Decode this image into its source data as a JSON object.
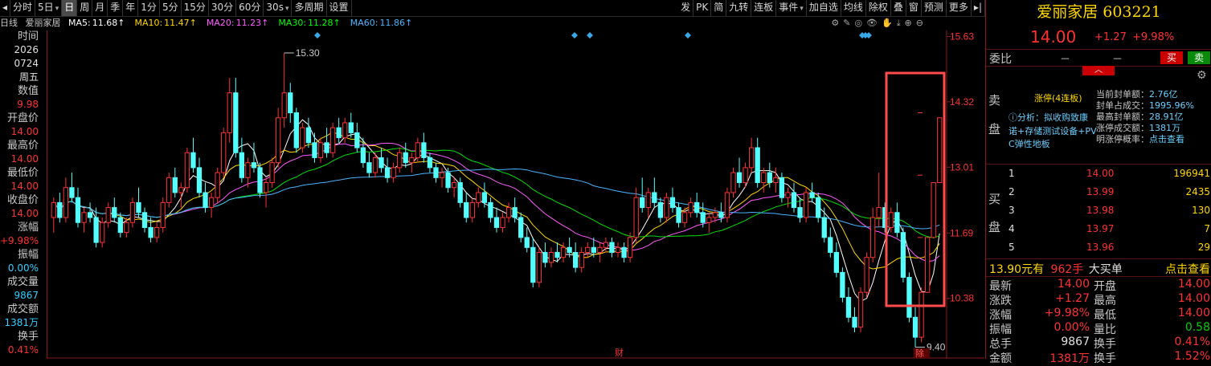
{
  "toolbar": {
    "left_items": [
      "分时",
      "5日",
      "日",
      "周",
      "月",
      "季",
      "年",
      "1分",
      "5分",
      "15分",
      "30分",
      "60分",
      "30s",
      "多周期",
      "设置"
    ],
    "active_item": "日",
    "right_items": [
      "发",
      "PK",
      "简",
      "九转",
      "连板",
      "事件",
      "加自选",
      "均线",
      "除权",
      "叠",
      "窗",
      "预测",
      "更多"
    ]
  },
  "infobar": {
    "period": "日线",
    "name": "爱丽家居",
    "ma": [
      {
        "label": "MA5:",
        "value": "11.68",
        "color": "#ffffff"
      },
      {
        "label": "MA10:",
        "value": "11.47",
        "color": "#ffd700"
      },
      {
        "label": "MA20:",
        "value": "11.23",
        "color": "#ff5aff"
      },
      {
        "label": "MA30:",
        "value": "11.28",
        "color": "#00ff00"
      },
      {
        "label": "MA60:",
        "value": "11.86",
        "color": "#4ab4ff"
      }
    ],
    "arrow": "↑"
  },
  "left_panel": [
    {
      "text": "时间",
      "kind": "lbl"
    },
    {
      "text": "2026",
      "kind": "val-white"
    },
    {
      "text": "0724",
      "kind": "val-white"
    },
    {
      "text": "周五",
      "kind": "val-white"
    },
    {
      "text": "数值",
      "kind": "lbl"
    },
    {
      "text": "9.98",
      "kind": "val-red"
    },
    {
      "text": "开盘价",
      "kind": "lbl"
    },
    {
      "text": "14.00",
      "kind": "val-red"
    },
    {
      "text": "最高价",
      "kind": "lbl"
    },
    {
      "text": "14.00",
      "kind": "val-red"
    },
    {
      "text": "最低价",
      "kind": "lbl"
    },
    {
      "text": "14.00",
      "kind": "val-red"
    },
    {
      "text": "收盘价",
      "kind": "lbl"
    },
    {
      "text": "14.00",
      "kind": "val-red"
    },
    {
      "text": "涨幅",
      "kind": "lbl"
    },
    {
      "text": "+9.98%",
      "kind": "val-red"
    },
    {
      "text": "振幅",
      "kind": "lbl"
    },
    {
      "text": "0.00%",
      "kind": "val-cyan"
    },
    {
      "text": "成交量",
      "kind": "lbl"
    },
    {
      "text": "9867",
      "kind": "val-cyan"
    },
    {
      "text": "成交额",
      "kind": "lbl"
    },
    {
      "text": "1381万",
      "kind": "val-cyan"
    },
    {
      "text": "换手",
      "kind": "lbl"
    },
    {
      "text": "0.41%",
      "kind": "val-red"
    }
  ],
  "chart_data": {
    "type": "candlestick",
    "y_ticks": [
      "15.63",
      "14.32",
      "13.01",
      "11.69",
      "10.38"
    ],
    "y_tick_values": [
      15.63,
      14.32,
      13.01,
      11.69,
      10.38
    ],
    "ylim": [
      9.2,
      15.75
    ],
    "high_label": "15.30",
    "low_label": "9.40",
    "markers": [
      "财",
      "除"
    ],
    "candles": [
      [
        12.0,
        12.4,
        11.7,
        12.3
      ],
      [
        12.3,
        12.5,
        11.9,
        12.0
      ],
      [
        12.0,
        12.8,
        11.9,
        12.6
      ],
      [
        12.6,
        12.9,
        12.3,
        12.4
      ],
      [
        12.4,
        12.6,
        11.8,
        11.9
      ],
      [
        11.9,
        12.2,
        11.7,
        12.1
      ],
      [
        12.1,
        12.3,
        11.9,
        12.0
      ],
      [
        12.0,
        12.2,
        11.4,
        11.5
      ],
      [
        11.5,
        12.0,
        11.4,
        11.9
      ],
      [
        11.9,
        12.3,
        11.8,
        12.2
      ],
      [
        12.2,
        12.4,
        11.9,
        12.0
      ],
      [
        12.0,
        12.1,
        11.6,
        11.7
      ],
      [
        11.7,
        12.0,
        11.6,
        11.9
      ],
      [
        11.9,
        12.4,
        11.8,
        12.3
      ],
      [
        12.3,
        12.6,
        12.0,
        12.1
      ],
      [
        12.1,
        12.2,
        11.7,
        11.8
      ],
      [
        11.8,
        12.0,
        11.5,
        11.6
      ],
      [
        11.6,
        11.9,
        11.5,
        11.8
      ],
      [
        11.8,
        12.4,
        11.7,
        12.3
      ],
      [
        12.3,
        12.9,
        12.2,
        12.8
      ],
      [
        12.8,
        13.0,
        12.4,
        12.5
      ],
      [
        12.5,
        12.7,
        12.2,
        12.6
      ],
      [
        12.6,
        13.4,
        12.5,
        13.3
      ],
      [
        13.3,
        13.6,
        12.9,
        13.0
      ],
      [
        13.0,
        13.2,
        12.4,
        12.5
      ],
      [
        12.5,
        12.7,
        12.1,
        12.2
      ],
      [
        12.2,
        12.5,
        12.0,
        12.4
      ],
      [
        12.4,
        13.0,
        12.3,
        12.9
      ],
      [
        12.9,
        13.8,
        12.8,
        13.7
      ],
      [
        13.7,
        14.8,
        13.5,
        14.5
      ],
      [
        14.5,
        14.8,
        13.2,
        13.3
      ],
      [
        13.3,
        13.6,
        12.7,
        12.8
      ],
      [
        12.8,
        13.2,
        12.6,
        13.1
      ],
      [
        13.1,
        13.5,
        12.9,
        13.0
      ],
      [
        13.0,
        13.1,
        12.4,
        12.5
      ],
      [
        12.5,
        12.8,
        12.2,
        12.7
      ],
      [
        12.7,
        13.2,
        12.6,
        13.1
      ],
      [
        13.1,
        14.2,
        13.0,
        14.0
      ],
      [
        14.0,
        15.3,
        13.8,
        14.5
      ],
      [
        14.5,
        14.7,
        13.9,
        14.1
      ],
      [
        14.1,
        14.2,
        13.3,
        13.4
      ],
      [
        13.4,
        13.9,
        13.3,
        13.8
      ],
      [
        13.8,
        14.0,
        13.4,
        13.5
      ],
      [
        13.5,
        13.7,
        13.1,
        13.2
      ],
      [
        13.2,
        13.6,
        13.1,
        13.5
      ],
      [
        13.5,
        13.8,
        13.2,
        13.3
      ],
      [
        13.3,
        13.9,
        13.2,
        13.8
      ],
      [
        13.8,
        14.0,
        13.5,
        13.6
      ],
      [
        13.6,
        14.0,
        13.5,
        13.9
      ],
      [
        13.9,
        14.1,
        13.6,
        13.7
      ],
      [
        13.7,
        13.9,
        13.3,
        13.4
      ],
      [
        13.4,
        13.6,
        13.0,
        13.1
      ],
      [
        13.1,
        13.3,
        12.8,
        12.9
      ],
      [
        12.9,
        13.3,
        12.8,
        13.2
      ],
      [
        13.2,
        13.4,
        12.9,
        13.0
      ],
      [
        13.0,
        13.2,
        12.7,
        12.8
      ],
      [
        12.8,
        13.1,
        12.7,
        13.0
      ],
      [
        13.0,
        13.4,
        12.9,
        13.3
      ],
      [
        13.3,
        13.5,
        13.0,
        13.1
      ],
      [
        13.1,
        13.3,
        12.9,
        13.2
      ],
      [
        13.2,
        13.6,
        13.1,
        13.5
      ],
      [
        13.5,
        13.7,
        13.1,
        13.2
      ],
      [
        13.2,
        13.3,
        12.9,
        13.0
      ],
      [
        13.0,
        13.1,
        12.7,
        12.8
      ],
      [
        12.8,
        13.0,
        12.6,
        12.9
      ],
      [
        12.9,
        13.0,
        12.5,
        12.6
      ],
      [
        12.6,
        12.8,
        12.4,
        12.7
      ],
      [
        12.7,
        12.8,
        12.2,
        12.3
      ],
      [
        12.3,
        12.5,
        11.9,
        12.0
      ],
      [
        12.0,
        12.4,
        11.9,
        12.3
      ],
      [
        12.3,
        12.6,
        12.2,
        12.5
      ],
      [
        12.5,
        12.7,
        12.2,
        12.3
      ],
      [
        12.3,
        12.4,
        11.9,
        12.0
      ],
      [
        12.0,
        12.2,
        11.7,
        11.8
      ],
      [
        11.8,
        12.1,
        11.7,
        12.0
      ],
      [
        12.0,
        12.3,
        11.9,
        12.2
      ],
      [
        12.2,
        12.4,
        11.9,
        12.0
      ],
      [
        12.0,
        12.1,
        11.5,
        11.6
      ],
      [
        11.6,
        11.8,
        11.3,
        11.4
      ],
      [
        11.4,
        11.6,
        10.6,
        10.7
      ],
      [
        10.7,
        11.4,
        10.6,
        11.3
      ],
      [
        11.3,
        11.5,
        11.0,
        11.1
      ],
      [
        11.1,
        11.4,
        11.0,
        11.3
      ],
      [
        11.3,
        11.5,
        11.1,
        11.2
      ],
      [
        11.2,
        11.5,
        11.1,
        11.4
      ],
      [
        11.4,
        11.6,
        11.2,
        11.3
      ],
      [
        11.3,
        11.5,
        10.9,
        11.0
      ],
      [
        11.0,
        11.4,
        10.9,
        11.3
      ],
      [
        11.3,
        11.5,
        11.2,
        11.4
      ],
      [
        11.4,
        11.6,
        11.2,
        11.3
      ],
      [
        11.3,
        11.5,
        11.1,
        11.4
      ],
      [
        11.4,
        11.6,
        11.3,
        11.5
      ],
      [
        11.5,
        11.6,
        11.2,
        11.3
      ],
      [
        11.3,
        11.5,
        11.2,
        11.4
      ],
      [
        11.4,
        11.5,
        11.1,
        11.2
      ],
      [
        11.2,
        11.7,
        11.1,
        11.6
      ],
      [
        11.6,
        12.6,
        11.5,
        12.4
      ],
      [
        12.4,
        12.8,
        12.1,
        12.2
      ],
      [
        12.2,
        12.6,
        12.0,
        12.5
      ],
      [
        12.5,
        12.8,
        12.2,
        12.3
      ],
      [
        12.3,
        12.4,
        11.9,
        12.0
      ],
      [
        12.0,
        12.5,
        11.9,
        12.4
      ],
      [
        12.4,
        12.6,
        12.1,
        12.2
      ],
      [
        12.2,
        12.3,
        11.8,
        11.9
      ],
      [
        11.9,
        12.2,
        11.8,
        12.1
      ],
      [
        12.1,
        12.4,
        12.0,
        12.3
      ],
      [
        12.3,
        12.5,
        12.0,
        12.1
      ],
      [
        12.1,
        12.3,
        11.8,
        11.9
      ],
      [
        11.9,
        12.1,
        11.7,
        12.0
      ],
      [
        12.0,
        12.2,
        11.9,
        12.1
      ],
      [
        12.1,
        12.3,
        11.9,
        12.0
      ],
      [
        12.0,
        12.6,
        11.9,
        12.5
      ],
      [
        12.5,
        13.0,
        12.4,
        12.9
      ],
      [
        12.9,
        13.2,
        12.6,
        12.7
      ],
      [
        12.7,
        13.1,
        12.6,
        13.0
      ],
      [
        13.0,
        13.6,
        12.9,
        13.4
      ],
      [
        13.4,
        13.6,
        12.6,
        12.7
      ],
      [
        12.7,
        13.0,
        12.5,
        12.9
      ],
      [
        12.9,
        13.1,
        12.6,
        12.7
      ],
      [
        12.7,
        13.0,
        12.5,
        12.8
      ],
      [
        12.8,
        12.9,
        12.3,
        12.4
      ],
      [
        12.4,
        12.6,
        12.2,
        12.5
      ],
      [
        12.5,
        12.7,
        12.1,
        12.2
      ],
      [
        12.2,
        12.4,
        11.9,
        12.0
      ],
      [
        12.0,
        12.6,
        11.9,
        12.5
      ],
      [
        12.5,
        12.7,
        12.3,
        12.4
      ],
      [
        12.4,
        12.5,
        11.9,
        12.0
      ],
      [
        12.0,
        12.2,
        11.5,
        11.6
      ],
      [
        11.6,
        11.8,
        11.2,
        11.3
      ],
      [
        11.3,
        11.5,
        10.8,
        10.9
      ],
      [
        10.9,
        11.0,
        10.3,
        10.4
      ],
      [
        10.4,
        10.6,
        9.9,
        10.0
      ],
      [
        10.0,
        10.2,
        9.7,
        9.8
      ],
      [
        9.8,
        10.6,
        9.7,
        10.5
      ],
      [
        10.5,
        11.3,
        10.4,
        11.2
      ],
      [
        11.2,
        12.2,
        11.1,
        12.0
      ],
      [
        12.0,
        12.9,
        11.8,
        12.2
      ],
      [
        12.2,
        12.3,
        11.7,
        11.8
      ],
      [
        11.8,
        12.2,
        11.7,
        12.1
      ],
      [
        12.1,
        12.3,
        11.6,
        11.7
      ],
      [
        11.7,
        11.8,
        10.7,
        10.8
      ],
      [
        10.8,
        10.9,
        9.9,
        10.0
      ],
      [
        10.0,
        10.2,
        9.4,
        9.6
      ],
      [
        9.6,
        10.6,
        9.5,
        10.5
      ],
      [
        10.5,
        11.6,
        10.5,
        11.6
      ],
      [
        11.6,
        12.7,
        11.6,
        12.7
      ],
      [
        12.7,
        14.0,
        12.7,
        14.0
      ]
    ],
    "ma_series": [
      {
        "name": "MA5",
        "color": "#ffffff",
        "period": 5
      },
      {
        "name": "MA10",
        "color": "#ffd700",
        "period": 10
      },
      {
        "name": "MA20",
        "color": "#ff5aff",
        "period": 20
      },
      {
        "name": "MA30",
        "color": "#00e000",
        "period": 30
      },
      {
        "name": "MA60",
        "color": "#4ab4ff",
        "period": 60
      }
    ]
  },
  "right_panel": {
    "title": "爱丽家居 603221",
    "price": "14.00",
    "change": "+1.27",
    "change_pct": "+9.98%",
    "weibi_label": "委比",
    "weibi_dash1": "－",
    "weibi_dash2": "－",
    "sell_label": "买",
    "buy_label": "卖",
    "sell_side": [
      "卖",
      "盘"
    ],
    "buy_side": [
      "买",
      "盘"
    ],
    "limit": {
      "title": "涨停(4连板)",
      "analysis": "分析：拟收购致康",
      "tags1": "诺+存储测试设备+PV",
      "tags2": "C弹性地板",
      "items": [
        {
          "label": "当前封单额：",
          "value": "2.76亿"
        },
        {
          "label": "封单占成交：",
          "value": "1995.96%"
        },
        {
          "label": "最高封单额：",
          "value": "28.91亿"
        },
        {
          "label": "涨停成交额：",
          "value": "1381万"
        },
        {
          "label": "明涨停概率：",
          "value": "点击查看"
        }
      ]
    },
    "orders": [
      {
        "n": "1",
        "p": "14.00",
        "v": "196941"
      },
      {
        "n": "2",
        "p": "13.99",
        "v": "2435"
      },
      {
        "n": "3",
        "p": "13.98",
        "v": "130"
      },
      {
        "n": "4",
        "p": "13.97",
        "v": "7"
      },
      {
        "n": "5",
        "p": "13.96",
        "v": "29"
      }
    ],
    "big_order": {
      "price": "13.90",
      "unit": "元有",
      "qty": "962手",
      "label": "大买单",
      "link": "点击查看"
    },
    "stats": [
      {
        "l1": "最新",
        "v1": "14.00",
        "l2": "开盘",
        "v2": "14.00"
      },
      {
        "l1": "涨跌",
        "v1": "+1.27",
        "l2": "最高",
        "v2": "14.00"
      },
      {
        "l1": "涨幅",
        "v1": "+9.98%",
        "l2": "最低",
        "v2": "14.00"
      },
      {
        "l1": "振幅",
        "v1": "0.00%",
        "l2": "量比",
        "v2": "0.58"
      },
      {
        "l1": "总手",
        "v1": "9867",
        "l2": "换手",
        "v2": "0.41%"
      },
      {
        "l1": "金额",
        "v1": "1381万",
        "l2": "换手",
        "v2": "1.52%"
      }
    ]
  }
}
